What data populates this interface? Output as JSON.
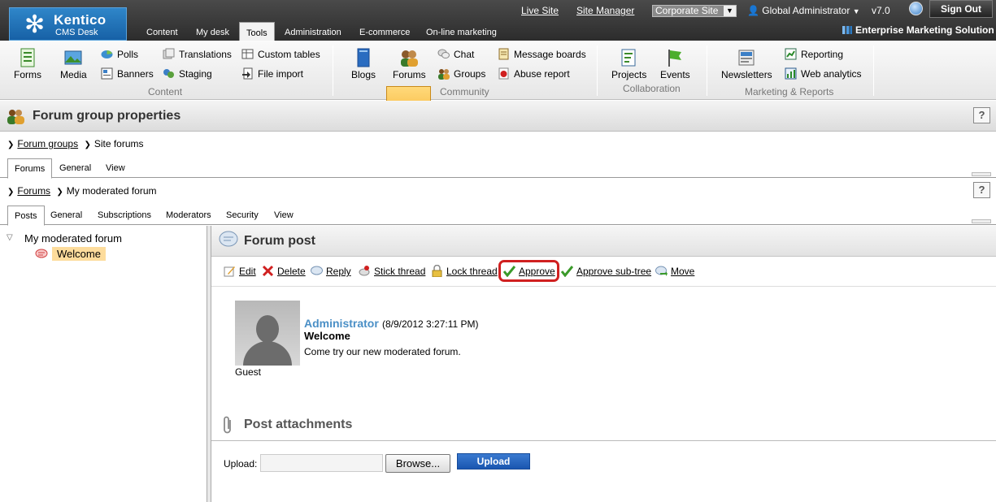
{
  "logo": {
    "brand": "Kentico",
    "product": "CMS Desk"
  },
  "top_links": {
    "live_site": "Live Site",
    "site_manager": "Site Manager"
  },
  "site_selector": {
    "value": "Corporate Site"
  },
  "user": {
    "name": "Global Administrator",
    "version": "v7.0",
    "sign_out": "Sign Out"
  },
  "ems": "Enterprise Marketing Solution",
  "main_tabs": [
    "Content",
    "My desk",
    "Tools",
    "Administration",
    "E-commerce",
    "On-line marketing"
  ],
  "ribbon": {
    "content": {
      "forms": "Forms",
      "media": "Media",
      "polls": "Polls",
      "banners": "Banners",
      "translations": "Translations",
      "staging": "Staging",
      "custom_tables": "Custom tables",
      "file_import": "File import",
      "group": "Content"
    },
    "community": {
      "blogs": "Blogs",
      "forums": "Forums",
      "chat": "Chat",
      "groups": "Groups",
      "message_boards": "Message boards",
      "abuse_report": "Abuse report",
      "group": "Community"
    },
    "collaboration": {
      "projects": "Projects",
      "events": "Events",
      "group": "Collaboration"
    },
    "marketing": {
      "newsletters": "Newsletters",
      "reporting": "Reporting",
      "web_analytics": "Web analytics",
      "group": "Marketing & Reports"
    }
  },
  "page_title": "Forum group properties",
  "breadcrumb1": {
    "link": "Forum groups",
    "current": "Site forums"
  },
  "tabs1": [
    "Forums",
    "General",
    "View"
  ],
  "breadcrumb2": {
    "link": "Forums",
    "current": "My moderated forum"
  },
  "tabs2": [
    "Posts",
    "General",
    "Subscriptions",
    "Moderators",
    "Security",
    "View"
  ],
  "tree": {
    "root": "My moderated forum",
    "child": "Welcome"
  },
  "forum_post": {
    "title": "Forum post",
    "actions": [
      "Edit",
      "Delete",
      "Reply",
      "Stick thread",
      "Lock thread",
      "Approve",
      "Approve sub-tree",
      "Move"
    ]
  },
  "post": {
    "author": "Administrator",
    "date": "(8/9/2012 3:27:11 PM)",
    "subject": "Welcome",
    "body": "Come try our new moderated forum.",
    "avatar_label": "Guest"
  },
  "attachments": {
    "title": "Post attachments",
    "upload_label": "Upload:",
    "browse": "Browse...",
    "upload_button": "Upload"
  },
  "help": "?",
  "colors": {
    "topbar": "#2c2c2c",
    "logo": "#1761a6",
    "active_tool": "#f6b43a",
    "author": "#4a8fc6",
    "approve_highlight": "#d02020",
    "upload_button": "#1a56b0"
  }
}
